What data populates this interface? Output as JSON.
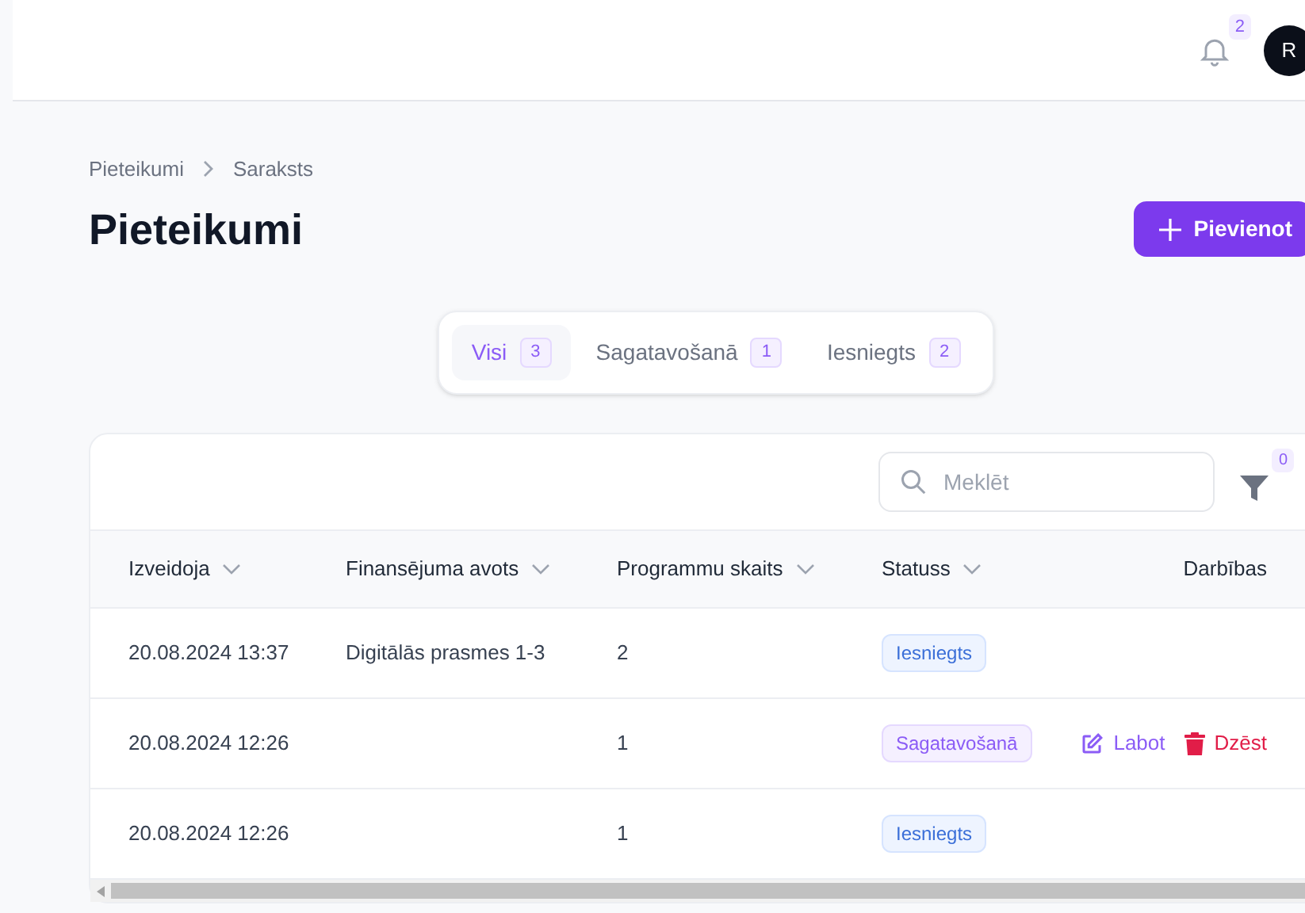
{
  "header": {
    "notification_count": "2",
    "avatar_initial": "R"
  },
  "breadcrumb": [
    "Pieteikumi",
    "Saraksts"
  ],
  "title": "Pieteikumi",
  "add_button": "Pievienot",
  "tabs": [
    {
      "label": "Visi",
      "count": "3",
      "selected": true
    },
    {
      "label": "Sagatavošanā",
      "count": "1",
      "selected": false
    },
    {
      "label": "Iesniegts",
      "count": "2",
      "selected": false
    }
  ],
  "search": {
    "placeholder": "Meklēt"
  },
  "filter_count": "0",
  "table": {
    "columns": [
      {
        "label": "Izveidoja",
        "sortable": true
      },
      {
        "label": "Finansējuma avots",
        "sortable": true
      },
      {
        "label": "Programmu skaits",
        "sortable": true
      },
      {
        "label": "Statuss",
        "sortable": true
      },
      {
        "label": "Darbības",
        "sortable": false
      }
    ],
    "rows": [
      {
        "created": "20.08.2024 13:37",
        "source": "Digitālās prasmes 1-3",
        "count": "2",
        "status": {
          "kind": "submitted",
          "label": "Iesniegts"
        },
        "actions": []
      },
      {
        "created": "20.08.2024 12:26",
        "source": "",
        "count": "1",
        "status": {
          "kind": "draft",
          "label": "Sagatavošanā"
        },
        "actions": [
          {
            "kind": "edit",
            "label": "Labot"
          },
          {
            "kind": "delete",
            "label": "Dzēst"
          }
        ]
      },
      {
        "created": "20.08.2024 12:26",
        "source": "",
        "count": "1",
        "status": {
          "kind": "submitted",
          "label": "Iesniegts"
        },
        "actions": []
      }
    ]
  }
}
